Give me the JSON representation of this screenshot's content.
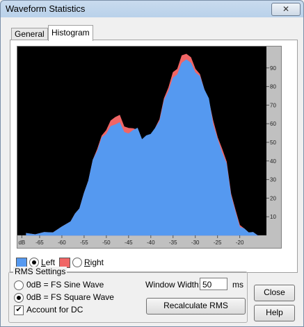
{
  "window": {
    "title": "Waveform Statistics",
    "close_glyph": "✕"
  },
  "tabs": [
    {
      "label": "General"
    },
    {
      "label": "Histogram"
    }
  ],
  "chart_data": {
    "type": "area",
    "x_tick_labels": [
      "dB",
      "-65",
      "-60",
      "-55",
      "-50",
      "-45",
      "-40",
      "-35",
      "-30",
      "-25",
      "-20"
    ],
    "y_tick_labels": [
      "10",
      "20",
      "30",
      "40",
      "50",
      "60",
      "70",
      "80",
      "90"
    ],
    "xlim": [
      -70,
      -14
    ],
    "ylim": [
      0,
      100
    ],
    "x": [
      -68,
      -66,
      -64,
      -62,
      -60,
      -58,
      -57,
      -56,
      -55,
      -54,
      -53,
      -52,
      -51,
      -50,
      -49,
      -48,
      -47,
      -46,
      -45,
      -44,
      -43,
      -42,
      -41,
      -40,
      -39,
      -38,
      -37,
      -36,
      -35,
      -34,
      -33,
      -32,
      -31,
      -30,
      -29,
      -28,
      -27,
      -26,
      -25,
      -24,
      -23,
      -22,
      -21,
      -20,
      -19,
      -18,
      -17,
      -16
    ],
    "series": [
      {
        "name": "Left",
        "color": "#5599f0",
        "values": [
          0.5,
          1,
          1,
          2,
          4,
          8,
          11,
          15,
          22,
          30,
          40,
          46,
          52,
          55,
          58,
          60,
          60,
          56,
          54,
          57,
          57,
          52,
          53,
          55,
          57,
          62,
          72,
          78,
          84,
          87,
          92,
          95,
          92,
          88,
          85,
          79,
          73,
          60,
          51,
          45,
          38,
          22,
          12,
          5,
          3,
          2,
          1,
          0.5
        ]
      },
      {
        "name": "Right",
        "color": "#f06565",
        "values": [
          0.5,
          1,
          1,
          2,
          4,
          8,
          11,
          15,
          22,
          30,
          40,
          47,
          53,
          57,
          61,
          64,
          64,
          59,
          57,
          58,
          56,
          51,
          52,
          54,
          57,
          63,
          73,
          80,
          87,
          90,
          96,
          98,
          95,
          90,
          86,
          79,
          72,
          62,
          52,
          47,
          39,
          23,
          13,
          6,
          3,
          2,
          1,
          0.5
        ]
      }
    ]
  },
  "legend": {
    "left_label": "Left",
    "right_label": "Right",
    "left_color": "#5599f0",
    "right_color": "#f06565",
    "selected": "Left"
  },
  "rms_settings": {
    "title": "RMS Settings",
    "option_sine": "0dB = FS Sine Wave",
    "option_square": "0dB = FS Square Wave",
    "selected": "0dB = FS Square Wave",
    "account_dc_label": "Account for DC",
    "account_dc_checked": true,
    "window_width_label": "Window Width:",
    "window_width_value": "50",
    "window_width_unit": "ms",
    "recalc_label": "Recalculate RMS"
  },
  "buttons": {
    "close_label": "Close",
    "help_label": "Help"
  }
}
